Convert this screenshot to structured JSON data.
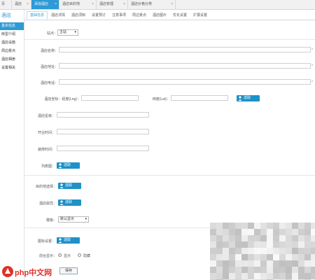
{
  "top_tabs": [
    {
      "label": "页",
      "active": false
    },
    {
      "label": "酒店",
      "active": false
    },
    {
      "label": "添加酒店",
      "active": true
    },
    {
      "label": "酒店目的地",
      "active": false
    },
    {
      "label": "酒店管理",
      "active": false
    },
    {
      "label": "酒店价格分类",
      "active": false
    }
  ],
  "sidebar": {
    "title": "酒店",
    "items": [
      "基本信息",
      "房型介绍",
      "酒店设施",
      "周边景点",
      "酒店相册",
      "设置相关"
    ]
  },
  "sub_tabs": [
    "基础信息",
    "酒店详情",
    "酒店须知",
    "设置预订",
    "注意事项",
    "周边景点",
    "酒店图片",
    "优化设置",
    "扩展设置"
  ],
  "form": {
    "owner_label": "站点：",
    "owner_value": "主站",
    "name_label": "酒店名称：",
    "name_side": "*",
    "address_label": "酒店地址：",
    "address_side": "*",
    "phone_label": "酒店电话：",
    "phone_side": "*",
    "coords_label": "酒店坐标：经度(Lng)：",
    "lat_label": "纬度(Lat)：",
    "map_button": "选取",
    "star_label": "酒店星级：",
    "open_label": "开业时间：",
    "renovate_label": "装修时间：",
    "upload_label": "列表图：",
    "upload_button": "选取",
    "dest_label": "目的地选择：",
    "dest_button": "选取",
    "theme_label": "酒店属性：",
    "theme_button": "选取",
    "template_label": "模板：",
    "template_value": "默认显示",
    "icon_label": "图标设置：",
    "icon_button": "选取",
    "show_label": "前台显示：",
    "show_yes": "显示",
    "show_no": "隐藏",
    "save_button": "保存"
  },
  "watermark": "php中文网",
  "colors": {
    "accent": "#2e9ad6",
    "button": "#1d91c8",
    "watermark_red": "#e0312a"
  }
}
